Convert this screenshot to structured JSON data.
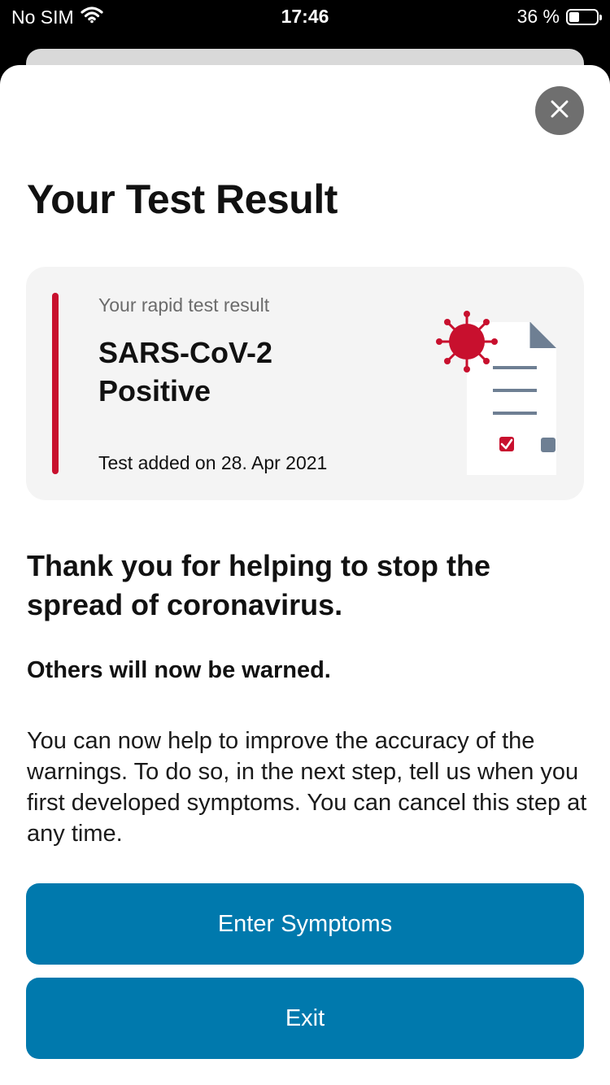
{
  "status_bar": {
    "carrier": "No SIM",
    "time": "17:46",
    "battery_percent_label": "36 %",
    "battery_level": 0.36,
    "wifi_icon": "wifi-icon",
    "battery_icon": "battery-icon"
  },
  "sheet": {
    "title": "Your Test Result",
    "close_icon": "close-icon"
  },
  "result_card": {
    "caption": "Your rapid test result",
    "result": "SARS-CoV-2 Positive",
    "date": "Test added on 28. Apr 2021",
    "accent_color": "#c8102e",
    "illustration_icon": "virus-document-icon"
  },
  "content": {
    "heading": "Thank you for helping to stop the spread of coronavirus.",
    "subheading": "Others will now be warned.",
    "body": "You can now help to improve the accuracy of the warnings. To do so, in the next step, tell us when you first developed symptoms. You can cancel this step at any time."
  },
  "actions": {
    "primary_label": "Enter Symptoms",
    "exit_label": "Exit",
    "button_color": "#0079ad"
  }
}
